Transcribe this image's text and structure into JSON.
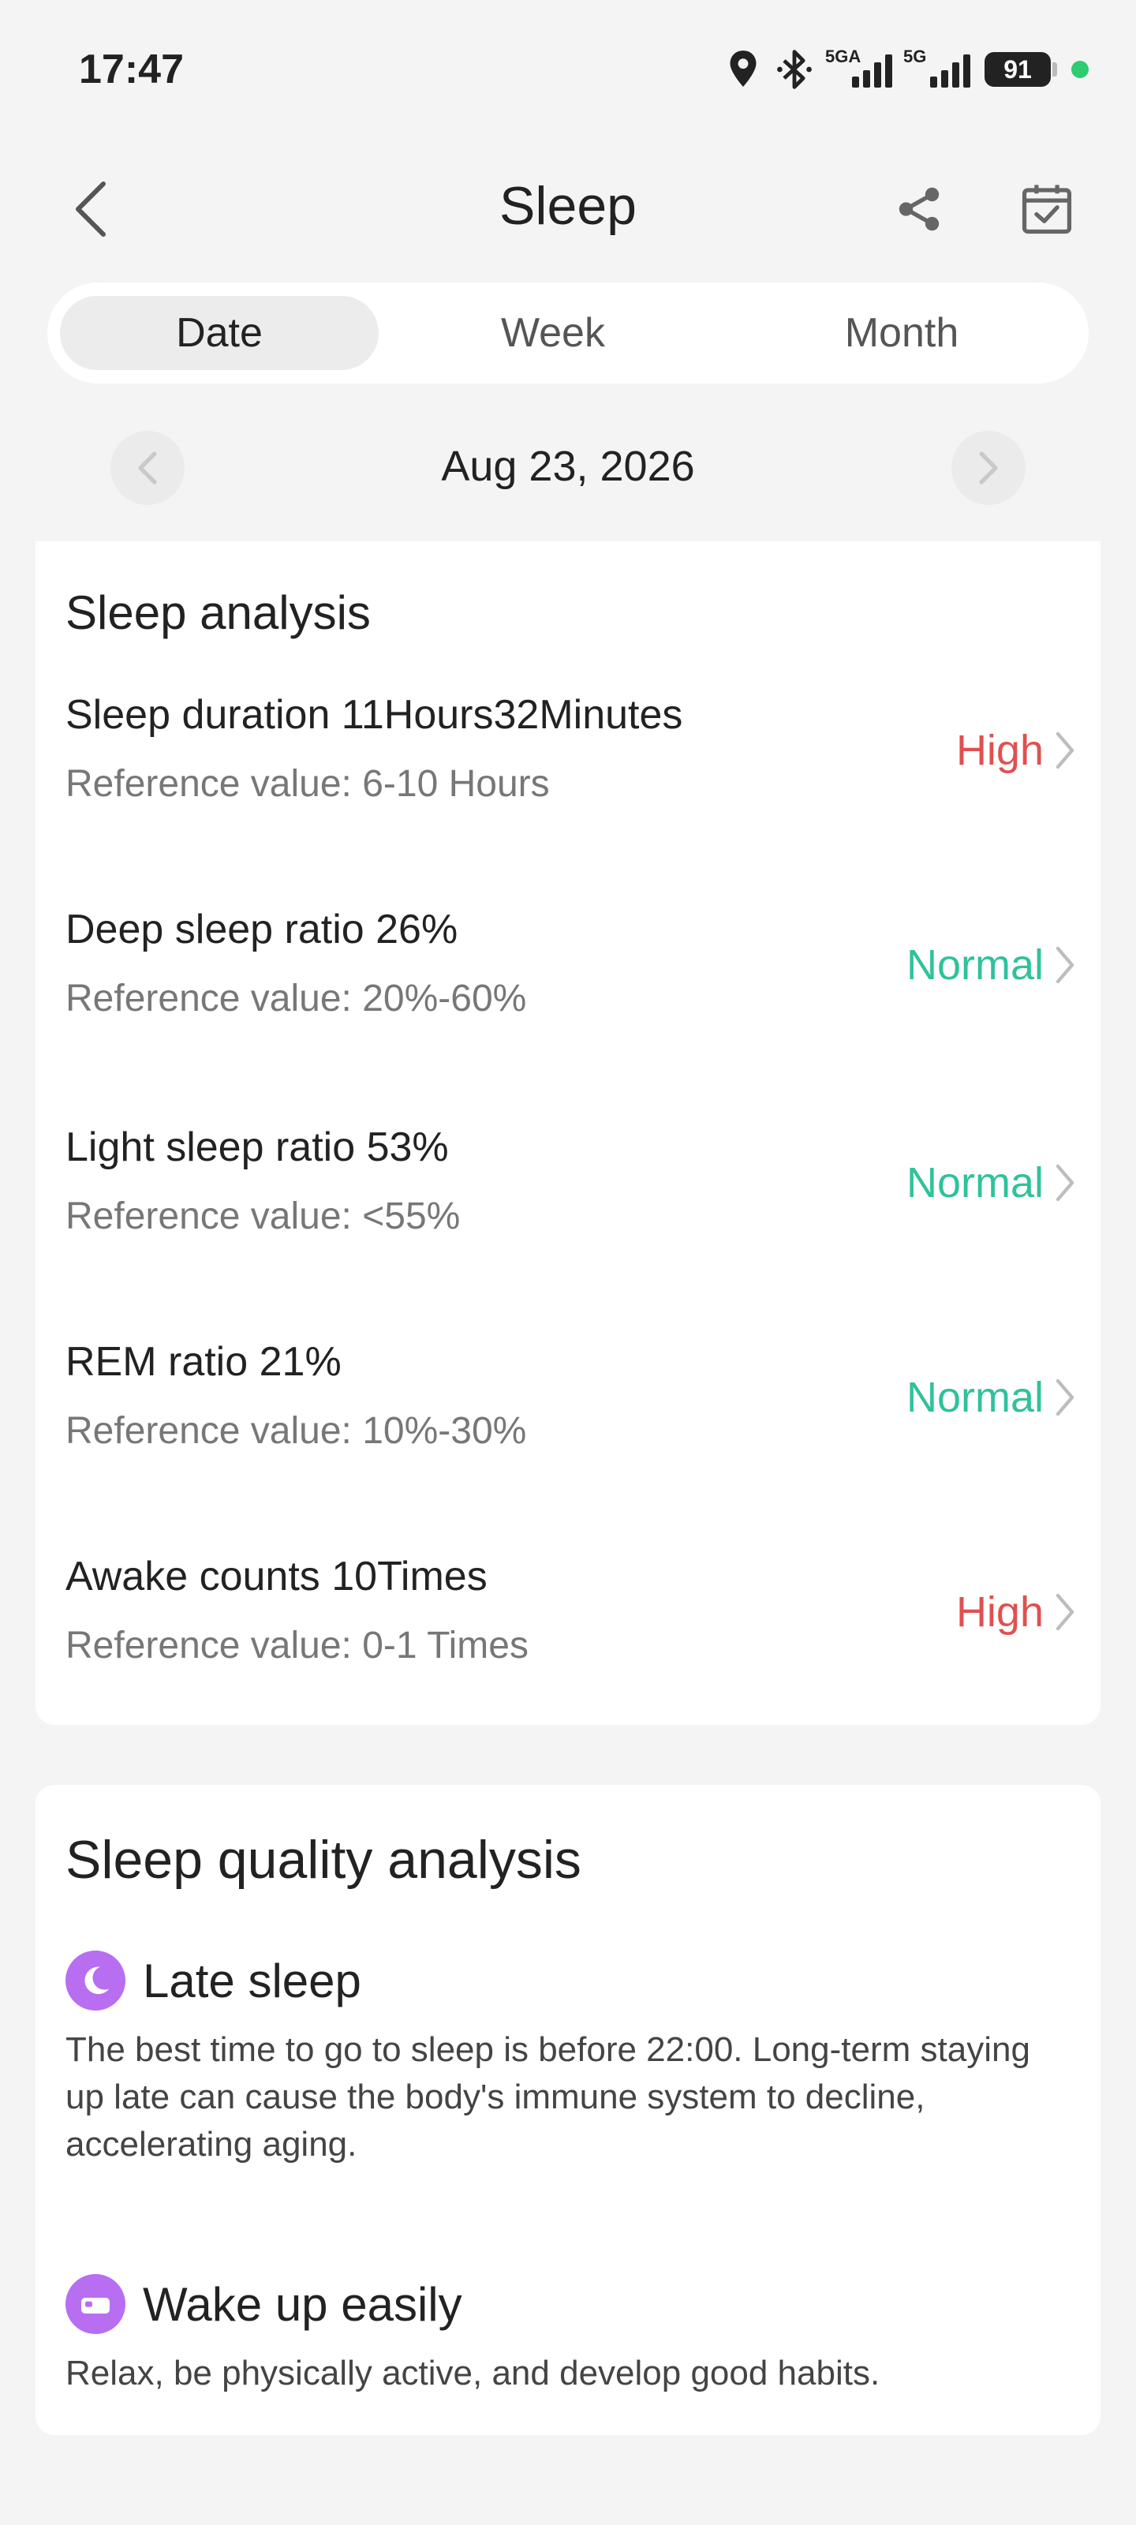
{
  "status_bar": {
    "time": "17:47",
    "network_1": "5GA",
    "network_2": "5G",
    "battery": "91"
  },
  "header": {
    "title": "Sleep"
  },
  "tabs": [
    {
      "label": "Date",
      "active": true
    },
    {
      "label": "Week",
      "active": false
    },
    {
      "label": "Month",
      "active": false
    }
  ],
  "date": "Aug 23, 2026",
  "sleep_analysis": {
    "title": "Sleep analysis",
    "metrics": [
      {
        "name": "Sleep duration 11Hours32Minutes",
        "ref": "Reference value:  6-10 Hours",
        "status": "High",
        "level": "high"
      },
      {
        "name": "Deep sleep ratio 26%",
        "ref": "Reference value:  20%-60%",
        "status": "Normal",
        "level": "normal"
      },
      {
        "name": "Light sleep ratio 53%",
        "ref": "Reference value:  <55%",
        "status": "Normal",
        "level": "normal"
      },
      {
        "name": "REM ratio 21%",
        "ref": "Reference value:  10%-30%",
        "status": "Normal",
        "level": "normal"
      },
      {
        "name": "Awake counts 10Times",
        "ref": "Reference value:  0-1 Times",
        "status": "High",
        "level": "high"
      }
    ]
  },
  "quality_analysis": {
    "title": "Sleep quality analysis",
    "items": [
      {
        "icon": "moon-icon",
        "title": "Late sleep",
        "desc": "The best time to go to sleep is before 22:00. Long-term staying up late can cause the body's immune system to decline, accelerating aging."
      },
      {
        "icon": "bed-icon",
        "title": "Wake up easily",
        "desc": "Relax, be physically active, and develop good habits."
      }
    ]
  },
  "colors": {
    "high": "#e05050",
    "normal": "#2fc29b",
    "icon_purple": "#b86ef0"
  }
}
